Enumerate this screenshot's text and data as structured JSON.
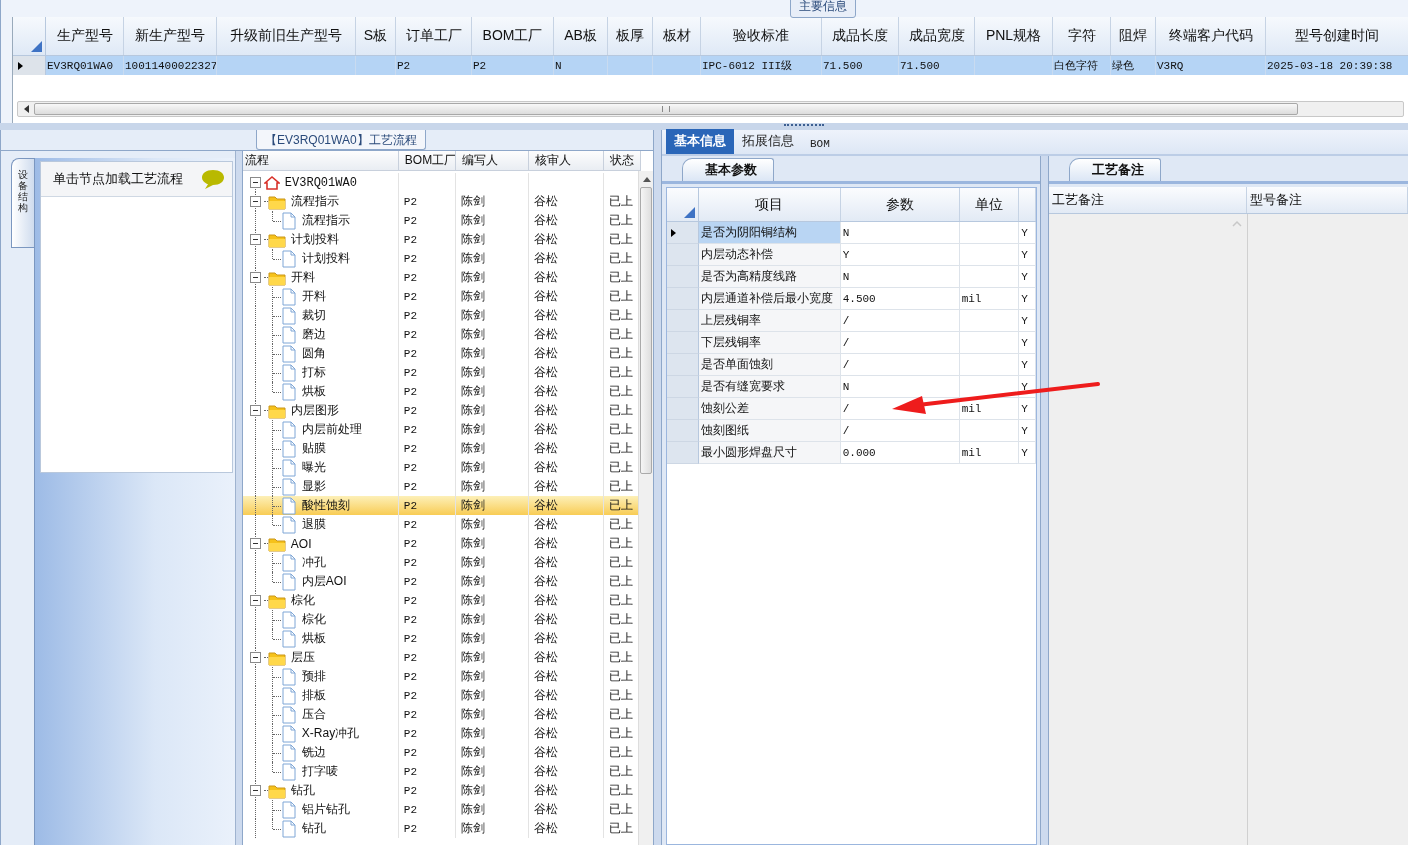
{
  "main_info": {
    "title": "主要信息",
    "table": {
      "columns": [
        "生产型号",
        "新生产型号",
        "升级前旧生产型号",
        "S板",
        "订单工厂",
        "BOM工厂",
        "AB板",
        "板厚",
        "板材",
        "验收标准",
        "成品长度",
        "成品宽度",
        "PNL规格",
        "字符",
        "阻焊",
        "终端客户代码",
        "型号创建时间"
      ],
      "rows": [
        {
          "selected": true,
          "cells": [
            "EV3RQ01WA0",
            "10011400022327",
            null,
            null,
            "P2",
            "P2",
            "N",
            null,
            null,
            "IPC-6012 III级",
            "71.500",
            "71.500",
            null,
            "白色字符",
            "绿色",
            "V3RQ",
            "2025-03-18 20:39:38"
          ]
        }
      ]
    }
  },
  "left_nav": {
    "vertical_tab": "设备结构",
    "hint": "单击节点加载工艺流程"
  },
  "flow": {
    "title": "【EV3RQ01WA0】工艺流程",
    "columns": [
      "流程",
      "BOM工厂",
      "编写人",
      "核审人",
      "状态"
    ],
    "root": {
      "label": "EV3RQ01WA0",
      "expanded": true,
      "selected": false,
      "children": [
        {
          "label": "流程指示",
          "bom": "P2",
          "writer": "陈剑",
          "reviewer": "谷松",
          "status": "已上",
          "expanded": true,
          "selected": false,
          "children": [
            {
              "label": "流程指示",
              "bom": "P2",
              "writer": "陈剑",
              "reviewer": "谷松",
              "status": "已上",
              "selected": false
            }
          ]
        },
        {
          "label": "计划投料",
          "bom": "P2",
          "writer": "陈剑",
          "reviewer": "谷松",
          "status": "已上",
          "expanded": true,
          "selected": false,
          "children": [
            {
              "label": "计划投料",
              "bom": "P2",
              "writer": "陈剑",
              "reviewer": "谷松",
              "status": "已上",
              "selected": false
            }
          ]
        },
        {
          "label": "开料",
          "bom": "P2",
          "writer": "陈剑",
          "reviewer": "谷松",
          "status": "已上",
          "expanded": true,
          "selected": false,
          "children": [
            {
              "label": "开料",
              "bom": "P2",
              "writer": "陈剑",
              "reviewer": "谷松",
              "status": "已上",
              "selected": false
            },
            {
              "label": "裁切",
              "bom": "P2",
              "writer": "陈剑",
              "reviewer": "谷松",
              "status": "已上",
              "selected": false
            },
            {
              "label": "磨边",
              "bom": "P2",
              "writer": "陈剑",
              "reviewer": "谷松",
              "status": "已上",
              "selected": false
            },
            {
              "label": "圆角",
              "bom": "P2",
              "writer": "陈剑",
              "reviewer": "谷松",
              "status": "已上",
              "selected": false
            },
            {
              "label": "打标",
              "bom": "P2",
              "writer": "陈剑",
              "reviewer": "谷松",
              "status": "已上",
              "selected": false
            },
            {
              "label": "烘板",
              "bom": "P2",
              "writer": "陈剑",
              "reviewer": "谷松",
              "status": "已上",
              "selected": false
            }
          ]
        },
        {
          "label": "内层图形",
          "bom": "P2",
          "writer": "陈剑",
          "reviewer": "谷松",
          "status": "已上",
          "expanded": true,
          "selected": false,
          "children": [
            {
              "label": "内层前处理",
              "bom": "P2",
              "writer": "陈剑",
              "reviewer": "谷松",
              "status": "已上",
              "selected": false
            },
            {
              "label": "贴膜",
              "bom": "P2",
              "writer": "陈剑",
              "reviewer": "谷松",
              "status": "已上",
              "selected": false
            },
            {
              "label": "曝光",
              "bom": "P2",
              "writer": "陈剑",
              "reviewer": "谷松",
              "status": "已上",
              "selected": false
            },
            {
              "label": "显影",
              "bom": "P2",
              "writer": "陈剑",
              "reviewer": "谷松",
              "status": "已上",
              "selected": false
            },
            {
              "label": "酸性蚀刻",
              "bom": "P2",
              "writer": "陈剑",
              "reviewer": "谷松",
              "status": "已上",
              "selected": true
            },
            {
              "label": "退膜",
              "bom": "P2",
              "writer": "陈剑",
              "reviewer": "谷松",
              "status": "已上",
              "selected": false
            }
          ]
        },
        {
          "label": "AOI",
          "bom": "P2",
          "writer": "陈剑",
          "reviewer": "谷松",
          "status": "已上",
          "expanded": true,
          "selected": false,
          "children": [
            {
              "label": "冲孔",
              "bom": "P2",
              "writer": "陈剑",
              "reviewer": "谷松",
              "status": "已上",
              "selected": false
            },
            {
              "label": "内层AOI",
              "bom": "P2",
              "writer": "陈剑",
              "reviewer": "谷松",
              "status": "已上",
              "selected": false
            }
          ]
        },
        {
          "label": "棕化",
          "bom": "P2",
          "writer": "陈剑",
          "reviewer": "谷松",
          "status": "已上",
          "expanded": true,
          "selected": false,
          "children": [
            {
              "label": "棕化",
              "bom": "P2",
              "writer": "陈剑",
              "reviewer": "谷松",
              "status": "已上",
              "selected": false
            },
            {
              "label": "烘板",
              "bom": "P2",
              "writer": "陈剑",
              "reviewer": "谷松",
              "status": "已上",
              "selected": false
            }
          ]
        },
        {
          "label": "层压",
          "bom": "P2",
          "writer": "陈剑",
          "reviewer": "谷松",
          "status": "已上",
          "expanded": true,
          "selected": false,
          "children": [
            {
              "label": "预排",
              "bom": "P2",
              "writer": "陈剑",
              "reviewer": "谷松",
              "status": "已上",
              "selected": false
            },
            {
              "label": "排板",
              "bom": "P2",
              "writer": "陈剑",
              "reviewer": "谷松",
              "status": "已上",
              "selected": false
            },
            {
              "label": "压合",
              "bom": "P2",
              "writer": "陈剑",
              "reviewer": "谷松",
              "status": "已上",
              "selected": false
            },
            {
              "label": "X-Ray冲孔",
              "bom": "P2",
              "writer": "陈剑",
              "reviewer": "谷松",
              "status": "已上",
              "selected": false
            },
            {
              "label": "铣边",
              "bom": "P2",
              "writer": "陈剑",
              "reviewer": "谷松",
              "status": "已上",
              "selected": false
            },
            {
              "label": "打字唛",
              "bom": "P2",
              "writer": "陈剑",
              "reviewer": "谷松",
              "status": "已上",
              "selected": false
            }
          ]
        },
        {
          "label": "钻孔",
          "bom": "P2",
          "writer": "陈剑",
          "reviewer": "谷松",
          "status": "已上",
          "expanded": true,
          "selected": false,
          "children": [
            {
              "label": "铝片钻孔",
              "bom": "P2",
              "writer": "陈剑",
              "reviewer": "谷松",
              "status": "已上",
              "selected": false
            },
            {
              "label": "钻孔",
              "bom": "P2",
              "writer": "陈剑",
              "reviewer": "谷松",
              "status": "已上",
              "selected": false
            }
          ]
        }
      ]
    }
  },
  "detail_tabs": [
    {
      "label": "基本信息",
      "selected": true
    },
    {
      "label": "拓展信息",
      "selected": false
    },
    {
      "label": "BOM",
      "selected": false
    }
  ],
  "params": {
    "tab": "基本参数",
    "columns": [
      "项目",
      "参数",
      "单位"
    ],
    "rows": [
      {
        "item": "是否为阴阳铜结构",
        "value": "N",
        "column_4": "Y",
        "current": true
      },
      {
        "item": "内层动态补偿",
        "value": "Y",
        "column_4": "Y",
        "current": false
      },
      {
        "item": "是否为高精度线路",
        "value": "N",
        "column_4": "Y",
        "current": false
      },
      {
        "item": "内层通道补偿后最小宽度",
        "value": "4.500",
        "unit": "mil",
        "column_4": "Y",
        "current": false
      },
      {
        "item": "上层残铜率",
        "value": "/",
        "column_4": "Y",
        "current": false
      },
      {
        "item": "下层残铜率",
        "value": "/",
        "column_4": "Y",
        "current": false
      },
      {
        "item": "是否单面蚀刻",
        "value": "/",
        "column_4": "Y",
        "current": false
      },
      {
        "item": "是否有缝宽要求",
        "value": "N",
        "column_4": "Y",
        "current": false
      },
      {
        "item": "蚀刻公差",
        "value": "/",
        "unit": "mil",
        "column_4": "Y",
        "current": false
      },
      {
        "item": "蚀刻图纸",
        "value": "/",
        "column_4": "Y",
        "current": false
      },
      {
        "item": "最小圆形焊盘尺寸",
        "value": "0.000",
        "unit": "mil",
        "column_4": "Y",
        "current": false
      }
    ]
  },
  "notes": {
    "tab": "工艺备注",
    "columns": [
      "工艺备注",
      "型号备注"
    ]
  }
}
